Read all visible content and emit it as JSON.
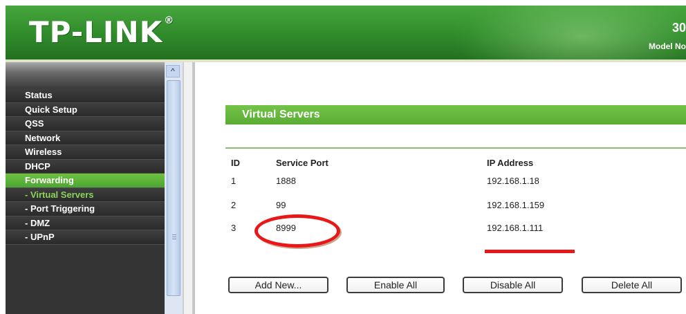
{
  "brand": {
    "logo": "TP-LINK",
    "logo_mark": "®",
    "model_partial": "30",
    "model_label": "Model No"
  },
  "sidebar": {
    "items": [
      {
        "label": "Status"
      },
      {
        "label": "Quick Setup"
      },
      {
        "label": "QSS"
      },
      {
        "label": "Network"
      },
      {
        "label": "Wireless"
      },
      {
        "label": "DHCP"
      },
      {
        "label": "Forwarding",
        "active": true
      },
      {
        "label": "- Virtual Servers",
        "sub": true,
        "selected": true
      },
      {
        "label": "- Port Triggering",
        "sub": true
      },
      {
        "label": "- DMZ",
        "sub": true
      },
      {
        "label": "- UPnP",
        "sub": true
      }
    ]
  },
  "scrollbar": {
    "up_arrow": "^"
  },
  "main": {
    "section_title": "Virtual Servers",
    "columns": {
      "id": "ID",
      "port": "Service Port",
      "ip": "IP Address"
    },
    "rows": [
      {
        "id": "1",
        "port": "1888",
        "ip": "192.168.1.18"
      },
      {
        "id": "2",
        "port": "99",
        "ip": "192.168.1.159"
      },
      {
        "id": "3",
        "port": "8999",
        "ip": "192.168.1.111"
      }
    ],
    "buttons": {
      "add_new": "Add New...",
      "enable_all": "Enable All",
      "disable_all": "Disable All",
      "delete_all": "Delete All"
    }
  },
  "colors": {
    "brand_green": "#2f8b2a",
    "section_green": "#5aac34",
    "annotation_red": "#e81818"
  },
  "icons": {
    "scroll_up": "chevron-up-icon"
  }
}
